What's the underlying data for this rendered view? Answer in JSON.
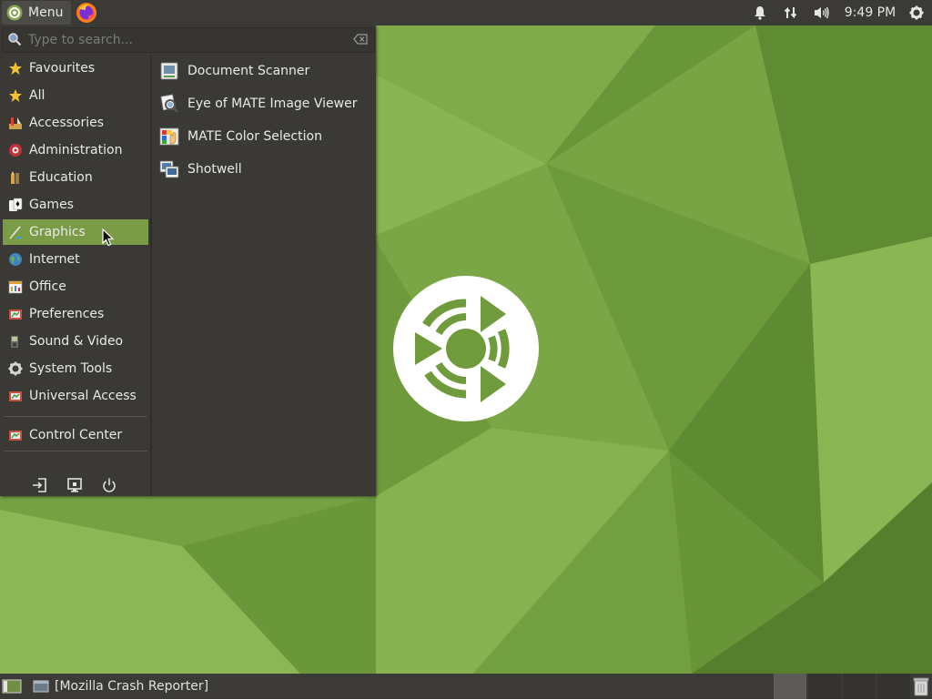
{
  "top_panel": {
    "menu_label": "Menu",
    "clock": "9:49 PM",
    "tray_icons": [
      "bell-icon",
      "network-icon",
      "volume-icon",
      "gear-icon"
    ]
  },
  "search": {
    "placeholder": "Type to search..."
  },
  "categories": [
    {
      "label": "Favourites",
      "icon": "star-icon"
    },
    {
      "label": "All",
      "icon": "star-icon"
    },
    {
      "label": "Accessories",
      "icon": "accessories-icon"
    },
    {
      "label": "Administration",
      "icon": "administration-icon"
    },
    {
      "label": "Education",
      "icon": "education-icon"
    },
    {
      "label": "Games",
      "icon": "games-icon"
    },
    {
      "label": "Graphics",
      "icon": "graphics-icon",
      "selected": true
    },
    {
      "label": "Internet",
      "icon": "globe-icon"
    },
    {
      "label": "Office",
      "icon": "office-icon"
    },
    {
      "label": "Preferences",
      "icon": "preferences-icon"
    },
    {
      "label": "Sound & Video",
      "icon": "sound-video-icon"
    },
    {
      "label": "System Tools",
      "icon": "gear-icon"
    },
    {
      "label": "Universal Access",
      "icon": "universal-access-icon"
    }
  ],
  "control_center": {
    "label": "Control Center",
    "icon": "control-center-icon"
  },
  "bottom_buttons": [
    "logout-icon",
    "lock-screen-icon",
    "power-icon"
  ],
  "apps": [
    {
      "label": "Document Scanner",
      "icon": "scanner-icon"
    },
    {
      "label": "Eye of MATE Image Viewer",
      "icon": "image-viewer-icon"
    },
    {
      "label": "MATE Color Selection",
      "icon": "color-selection-icon"
    },
    {
      "label": "Shotwell",
      "icon": "shotwell-icon"
    }
  ],
  "taskbar": {
    "task_label": "[Mozilla Crash Reporter]"
  },
  "colors": {
    "panel": "#3b3a37",
    "menu_bg": "#3a3936",
    "selection": "#7a9c47",
    "wallpaper": "#6f9b3c"
  }
}
